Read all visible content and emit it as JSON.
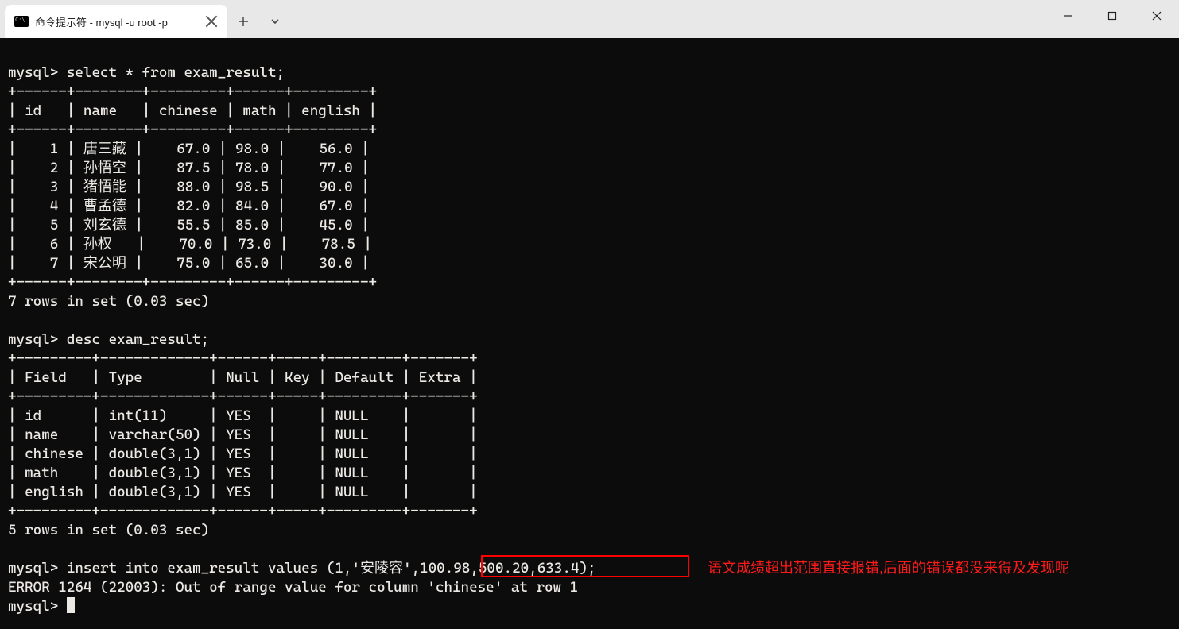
{
  "window": {
    "tab_title": "命令提示符 - mysql  -u root -p"
  },
  "terminal": {
    "prompt": "mysql>",
    "select_cmd": "select * from exam_result;",
    "table_top": "+------+--------+---------+------+---------+",
    "table_header": "| id   | name   | chinese | math | english |",
    "table_sep": "+------+--------+---------+------+---------+",
    "rows": [
      "|    1 | 唐三藏 |    67.0 | 98.0 |    56.0 |",
      "|    2 | 孙悟空 |    87.5 | 78.0 |    77.0 |",
      "|    3 | 猪悟能 |    88.0 | 98.5 |    90.0 |",
      "|    4 | 曹孟德 |    82.0 | 84.0 |    67.0 |",
      "|    5 | 刘玄德 |    55.5 | 85.0 |    45.0 |",
      "|    6 | 孙权   |    70.0 | 73.0 |    78.5 |",
      "|    7 | 宋公明 |    75.0 | 65.0 |    30.0 |"
    ],
    "table_bot": "+------+--------+---------+------+---------+",
    "rows_msg": "7 rows in set (0.03 sec)",
    "desc_cmd": "desc exam_result;",
    "desc_top": "+---------+-------------+------+-----+---------+-------+",
    "desc_header": "| Field   | Type        | Null | Key | Default | Extra |",
    "desc_sep": "+---------+-------------+------+-----+---------+-------+",
    "desc_rows": [
      "| id      | int(11)     | YES  |     | NULL    |       |",
      "| name    | varchar(50) | YES  |     | NULL    |       |",
      "| chinese | double(3,1) | YES  |     | NULL    |       |",
      "| math    | double(3,1) | YES  |     | NULL    |       |",
      "| english | double(3,1) | YES  |     | NULL    |       |"
    ],
    "desc_bot": "+---------+-------------+------+-----+---------+-------+",
    "desc_msg": "5 rows in set (0.03 sec)",
    "insert_cmd": "insert into exam_result values (1,'安陵容',100.98,500.20,633.4);",
    "error_msg": "ERROR 1264 (22003): Out of range value for column 'chinese' at row 1"
  },
  "annotation_text": "语文成绩超出范围直接报错,后面的错误都没来得及发现呢",
  "chart_data": {
    "type": "table",
    "tables": [
      {
        "name": "exam_result",
        "columns": [
          "id",
          "name",
          "chinese",
          "math",
          "english"
        ],
        "rows": [
          [
            1,
            "唐三藏",
            67.0,
            98.0,
            56.0
          ],
          [
            2,
            "孙悟空",
            87.5,
            78.0,
            77.0
          ],
          [
            3,
            "猪悟能",
            88.0,
            98.5,
            90.0
          ],
          [
            4,
            "曹孟德",
            82.0,
            84.0,
            67.0
          ],
          [
            5,
            "刘玄德",
            55.5,
            85.0,
            45.0
          ],
          [
            6,
            "孙权",
            70.0,
            73.0,
            78.5
          ],
          [
            7,
            "宋公明",
            75.0,
            65.0,
            30.0
          ]
        ]
      },
      {
        "name": "desc exam_result",
        "columns": [
          "Field",
          "Type",
          "Null",
          "Key",
          "Default",
          "Extra"
        ],
        "rows": [
          [
            "id",
            "int(11)",
            "YES",
            "",
            "NULL",
            ""
          ],
          [
            "name",
            "varchar(50)",
            "YES",
            "",
            "NULL",
            ""
          ],
          [
            "chinese",
            "double(3,1)",
            "YES",
            "",
            "NULL",
            ""
          ],
          [
            "math",
            "double(3,1)",
            "YES",
            "",
            "NULL",
            ""
          ],
          [
            "english",
            "double(3,1)",
            "YES",
            "",
            "NULL",
            ""
          ]
        ]
      }
    ]
  }
}
